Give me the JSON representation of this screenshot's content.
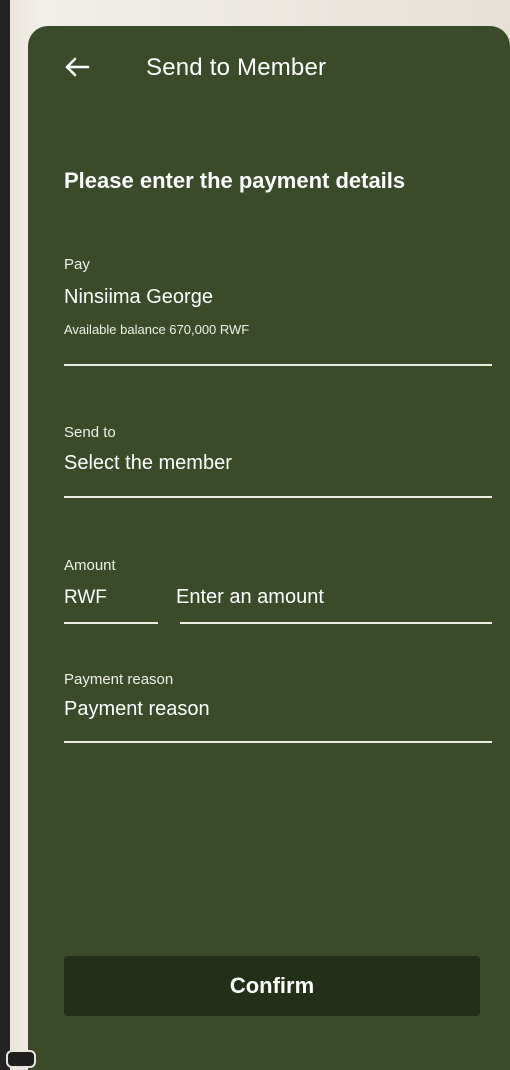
{
  "header": {
    "title": "Send to Member",
    "back_icon": "arrow-left-icon"
  },
  "instruction": "Please  enter the payment details",
  "form": {
    "pay": {
      "label": "Pay",
      "value": "Ninsiima George",
      "balance": "Available balance 670,000 RWF"
    },
    "send_to": {
      "label": "Send to",
      "placeholder": "Select the member"
    },
    "amount": {
      "label": "Amount",
      "currency": "RWF",
      "placeholder": "Enter an amount"
    },
    "reason": {
      "label": "Payment reason",
      "placeholder": "Payment reason"
    }
  },
  "confirm_label": "Confirm",
  "colors": {
    "card_background": "#3b4b2a",
    "button_background": "#233017",
    "text": "#ffffff"
  }
}
